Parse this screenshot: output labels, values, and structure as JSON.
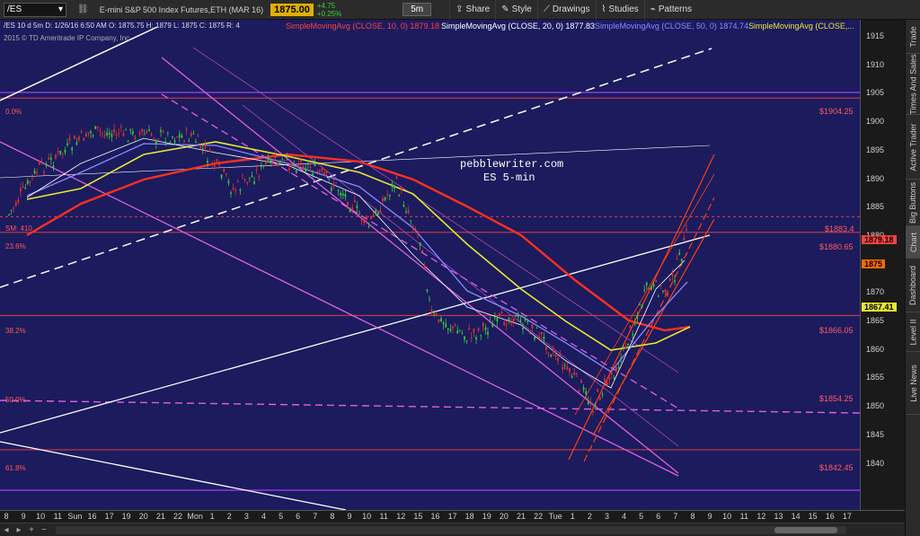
{
  "toolbar": {
    "symbol": "/ES",
    "description": "E-mini S&P 500 Index Futures,ETH (MAR 16)",
    "last_price": "1875.00",
    "change_abs": "+4.75",
    "change_pct": "+0.25%",
    "interval": "5m",
    "share_label": "Share",
    "style_label": "Style",
    "drawings_label": "Drawings",
    "studies_label": "Studies",
    "patterns_label": "Patterns"
  },
  "chart_header": {
    "ohlc": "/ES 10 d 5m   D: 1/26/16 6:50 AM   O: 1875.75   H: 1879   L: 1875   C: 1875   R: 4",
    "copyright": "2015 © TD Ameritrade IP Company, Inc.",
    "sma_legends": [
      {
        "text": "SimpleMovingAvg (CLOSE, 10, 0)",
        "value": "1879.18",
        "color": "#ff4040"
      },
      {
        "text": "SimpleMovingAvg (CLOSE, 20, 0)",
        "value": "1877.83",
        "color": "#ffffff"
      },
      {
        "text": "SimpleMovingAvg (CLOSE, 50, 0)",
        "value": "1874.74",
        "color": "#8a8aff"
      },
      {
        "text": "SimpleMovingAvg (CLOSE,...",
        "value": "",
        "color": "#e8e830"
      }
    ]
  },
  "watermark": {
    "line1": "pebblewriter.com",
    "line2": "ES 5-min"
  },
  "fib_levels": [
    {
      "pct": "0.0%",
      "price": "$1904.25"
    },
    {
      "pct": "23.6%",
      "price": "$1880.65"
    },
    {
      "pct": "38.2%",
      "price": "$1866.05"
    },
    {
      "pct": "50.0%",
      "price": "$1854.25"
    },
    {
      "pct": "61.8%",
      "price": "$1842.45"
    }
  ],
  "sm_label": "SM: 410",
  "sm_price": "$1883.4",
  "price_axis": {
    "ticks": [
      "1915",
      "1910",
      "1905",
      "1900",
      "1895",
      "1890",
      "1885",
      "1880",
      "1875",
      "1870",
      "1865",
      "1860",
      "1855",
      "1850",
      "1845",
      "1840"
    ],
    "flags": [
      {
        "value": "1879.18",
        "bg": "#ff4040",
        "fg": "#000000"
      },
      {
        "value": "1875",
        "bg": "#ff6a00",
        "fg": "#000000"
      },
      {
        "value": "1867.41",
        "bg": "#e8e830",
        "fg": "#000000"
      }
    ]
  },
  "time_axis": {
    "labels": [
      "8",
      "9",
      "10",
      "11",
      "Sun",
      "16",
      "17",
      "19",
      "20",
      "21",
      "22",
      "Mon",
      "1",
      "2",
      "3",
      "4",
      "5",
      "6",
      "7",
      "8",
      "9",
      "10",
      "11",
      "12",
      "15",
      "16",
      "17",
      "18",
      "19",
      "20",
      "21",
      "22",
      "Tue",
      "1",
      "2",
      "3",
      "4",
      "5",
      "6",
      "7",
      "8",
      "9",
      "10",
      "11",
      "12",
      "13",
      "14",
      "15",
      "16",
      "17"
    ]
  },
  "side_tabs": [
    "Trade",
    "Times And Sales",
    "Active Trader",
    "Big Buttons",
    "Chart",
    "Dashboard",
    "Level II",
    "Live News"
  ],
  "colors": {
    "background": "#1b1b5e",
    "fib_line": "#ff4040",
    "channel_magenta": "#e060e0",
    "channel_orange": "#ff4010",
    "purple_level": "#a040ff"
  }
}
